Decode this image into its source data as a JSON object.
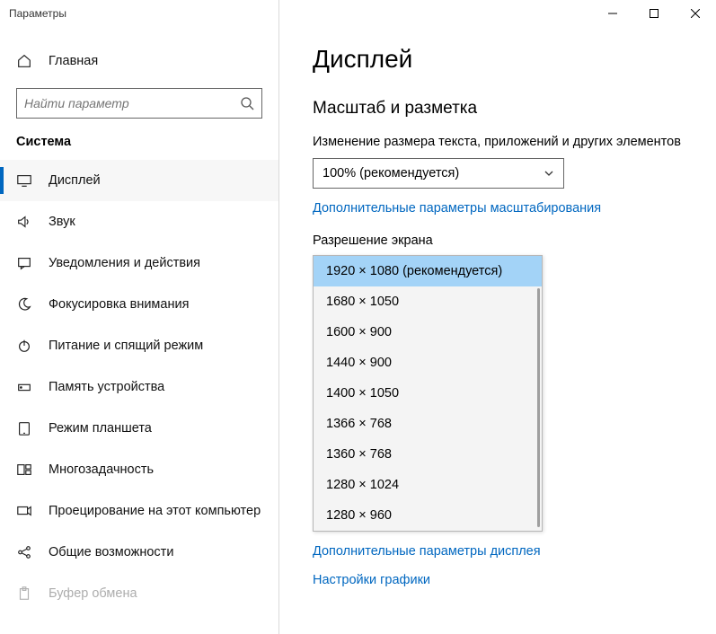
{
  "window": {
    "title": "Параметры"
  },
  "sidebar": {
    "home": "Главная",
    "search_placeholder": "Найти параметр",
    "category": "Система",
    "items": [
      {
        "label": "Дисплей"
      },
      {
        "label": "Звук"
      },
      {
        "label": "Уведомления и действия"
      },
      {
        "label": "Фокусировка внимания"
      },
      {
        "label": "Питание и спящий режим"
      },
      {
        "label": "Память устройства"
      },
      {
        "label": "Режим планшета"
      },
      {
        "label": "Многозадачность"
      },
      {
        "label": "Проецирование на этот компьютер"
      },
      {
        "label": "Общие возможности"
      },
      {
        "label": "Буфер обмена"
      }
    ]
  },
  "content": {
    "title": "Дисплей",
    "scale_heading": "Масштаб и разметка",
    "scale_label": "Изменение размера текста, приложений и других элементов",
    "scale_value": "100% (рекомендуется)",
    "scale_link": "Дополнительные параметры масштабирования",
    "resolution_label": "Разрешение экрана",
    "resolution_options": [
      "1920 × 1080 (рекомендуется)",
      "1680 × 1050",
      "1600 × 900",
      "1440 × 900",
      "1400 × 1050",
      "1366 × 768",
      "1360 × 768",
      "1280 × 1024",
      "1280 × 960"
    ],
    "adv_display_link": "Дополнительные параметры дисплея",
    "graphics_link": "Настройки графики"
  }
}
